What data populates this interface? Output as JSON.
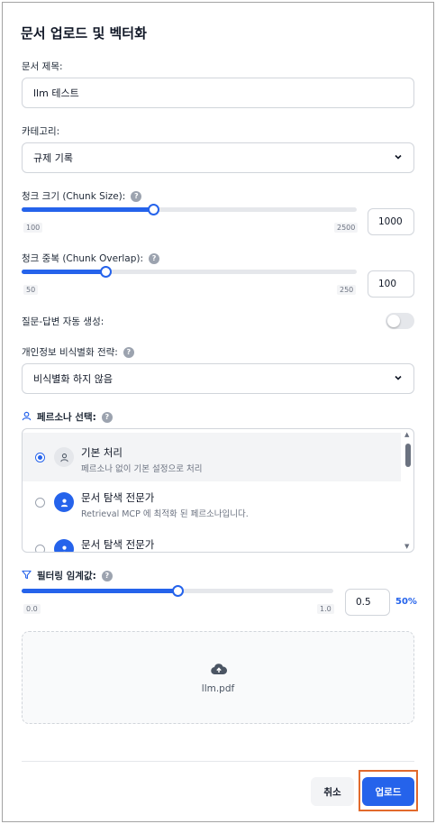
{
  "dialog": {
    "title": "문서 업로드 및 벡터화"
  },
  "doc_title": {
    "label": "문서 제목:",
    "value": "llm 테스트"
  },
  "category": {
    "label": "카테고리:",
    "selected": "규제 기록"
  },
  "chunk_size": {
    "label": "청크 크기 (Chunk Size):",
    "min": "100",
    "max": "2500",
    "value": "1000",
    "fraction": 0.3913
  },
  "chunk_overlap": {
    "label": "청크 중복 (Chunk Overlap):",
    "min": "50",
    "max": "250",
    "value": "100",
    "fraction": 0.25
  },
  "qa_generation": {
    "label": "질문-답변 자동 생성:",
    "enabled": false
  },
  "pii": {
    "label": "개인정보 비식별화 전략:",
    "selected": "비식별화 하지 않음"
  },
  "persona": {
    "label": "페르소나 선택:",
    "items": [
      {
        "name": "기본 처리",
        "desc": "페르소나 없이 기본 설정으로 처리",
        "selected": true
      },
      {
        "name": "문서 탐색 전문가",
        "desc": "Retrieval MCP 에 최적화 된 페르소나입니다.",
        "selected": false
      },
      {
        "name": "문서 탐색 전문가",
        "desc": "",
        "selected": false
      }
    ]
  },
  "filter_threshold": {
    "label": "필터링 임계값:",
    "min": "0.0",
    "max": "1.0",
    "value": "0.5",
    "percent": "50%",
    "fraction": 0.5
  },
  "dropzone": {
    "file_name": "llm.pdf"
  },
  "footer": {
    "cancel": "취소",
    "upload": "업로드"
  },
  "colors": {
    "accent": "#2563eb",
    "highlight_outline": "#e26a2c"
  }
}
